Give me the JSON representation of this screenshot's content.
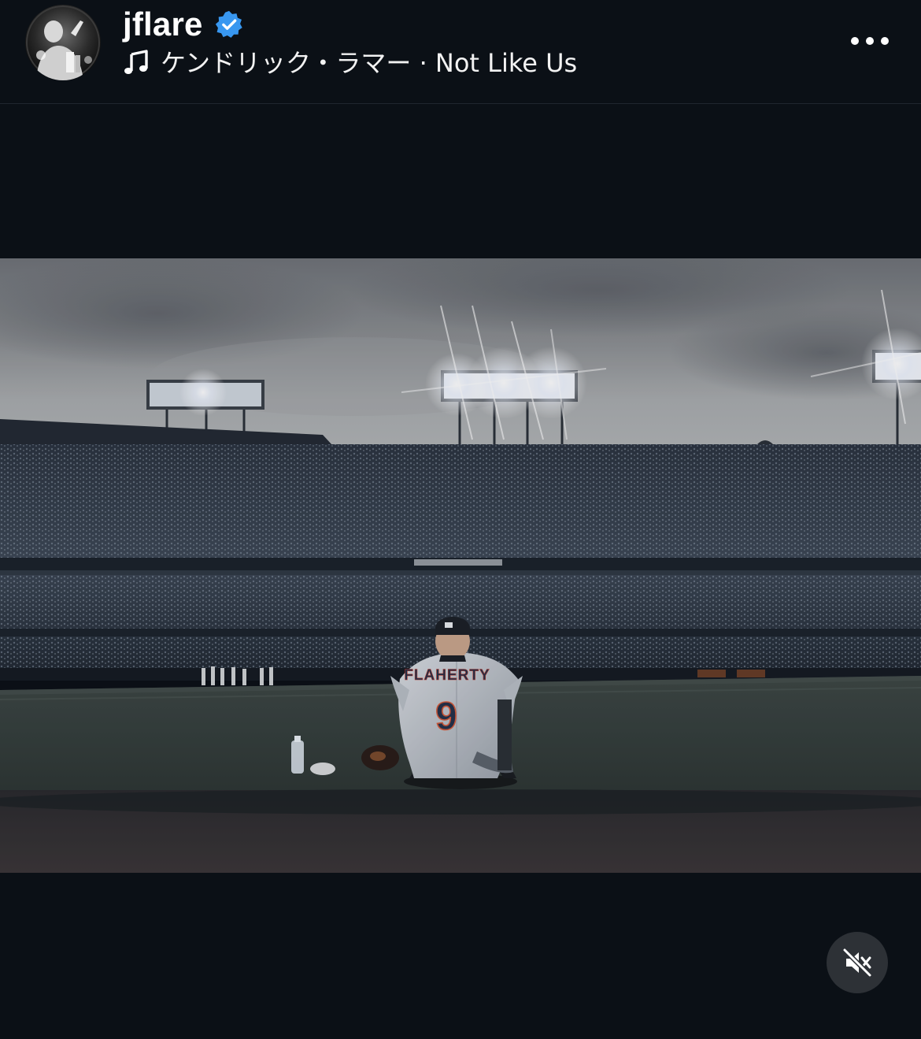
{
  "post": {
    "username": "jflare",
    "verified": true,
    "music": {
      "label": "ケンドリック・ラマー · Not Like Us",
      "icon": "music-note-icon"
    },
    "more_icon": "more-horizontal-icon",
    "avatar_icon": "avatar"
  },
  "media": {
    "jersey_name": "FLAHERTY",
    "jersey_number": "9",
    "sound": "muted",
    "mute_icon": "speaker-muted-icon"
  },
  "colors": {
    "background": "#0b1016",
    "text": "#ffffff",
    "verified_blue": "#3897f0",
    "mute_button_bg": "#2d3136"
  }
}
